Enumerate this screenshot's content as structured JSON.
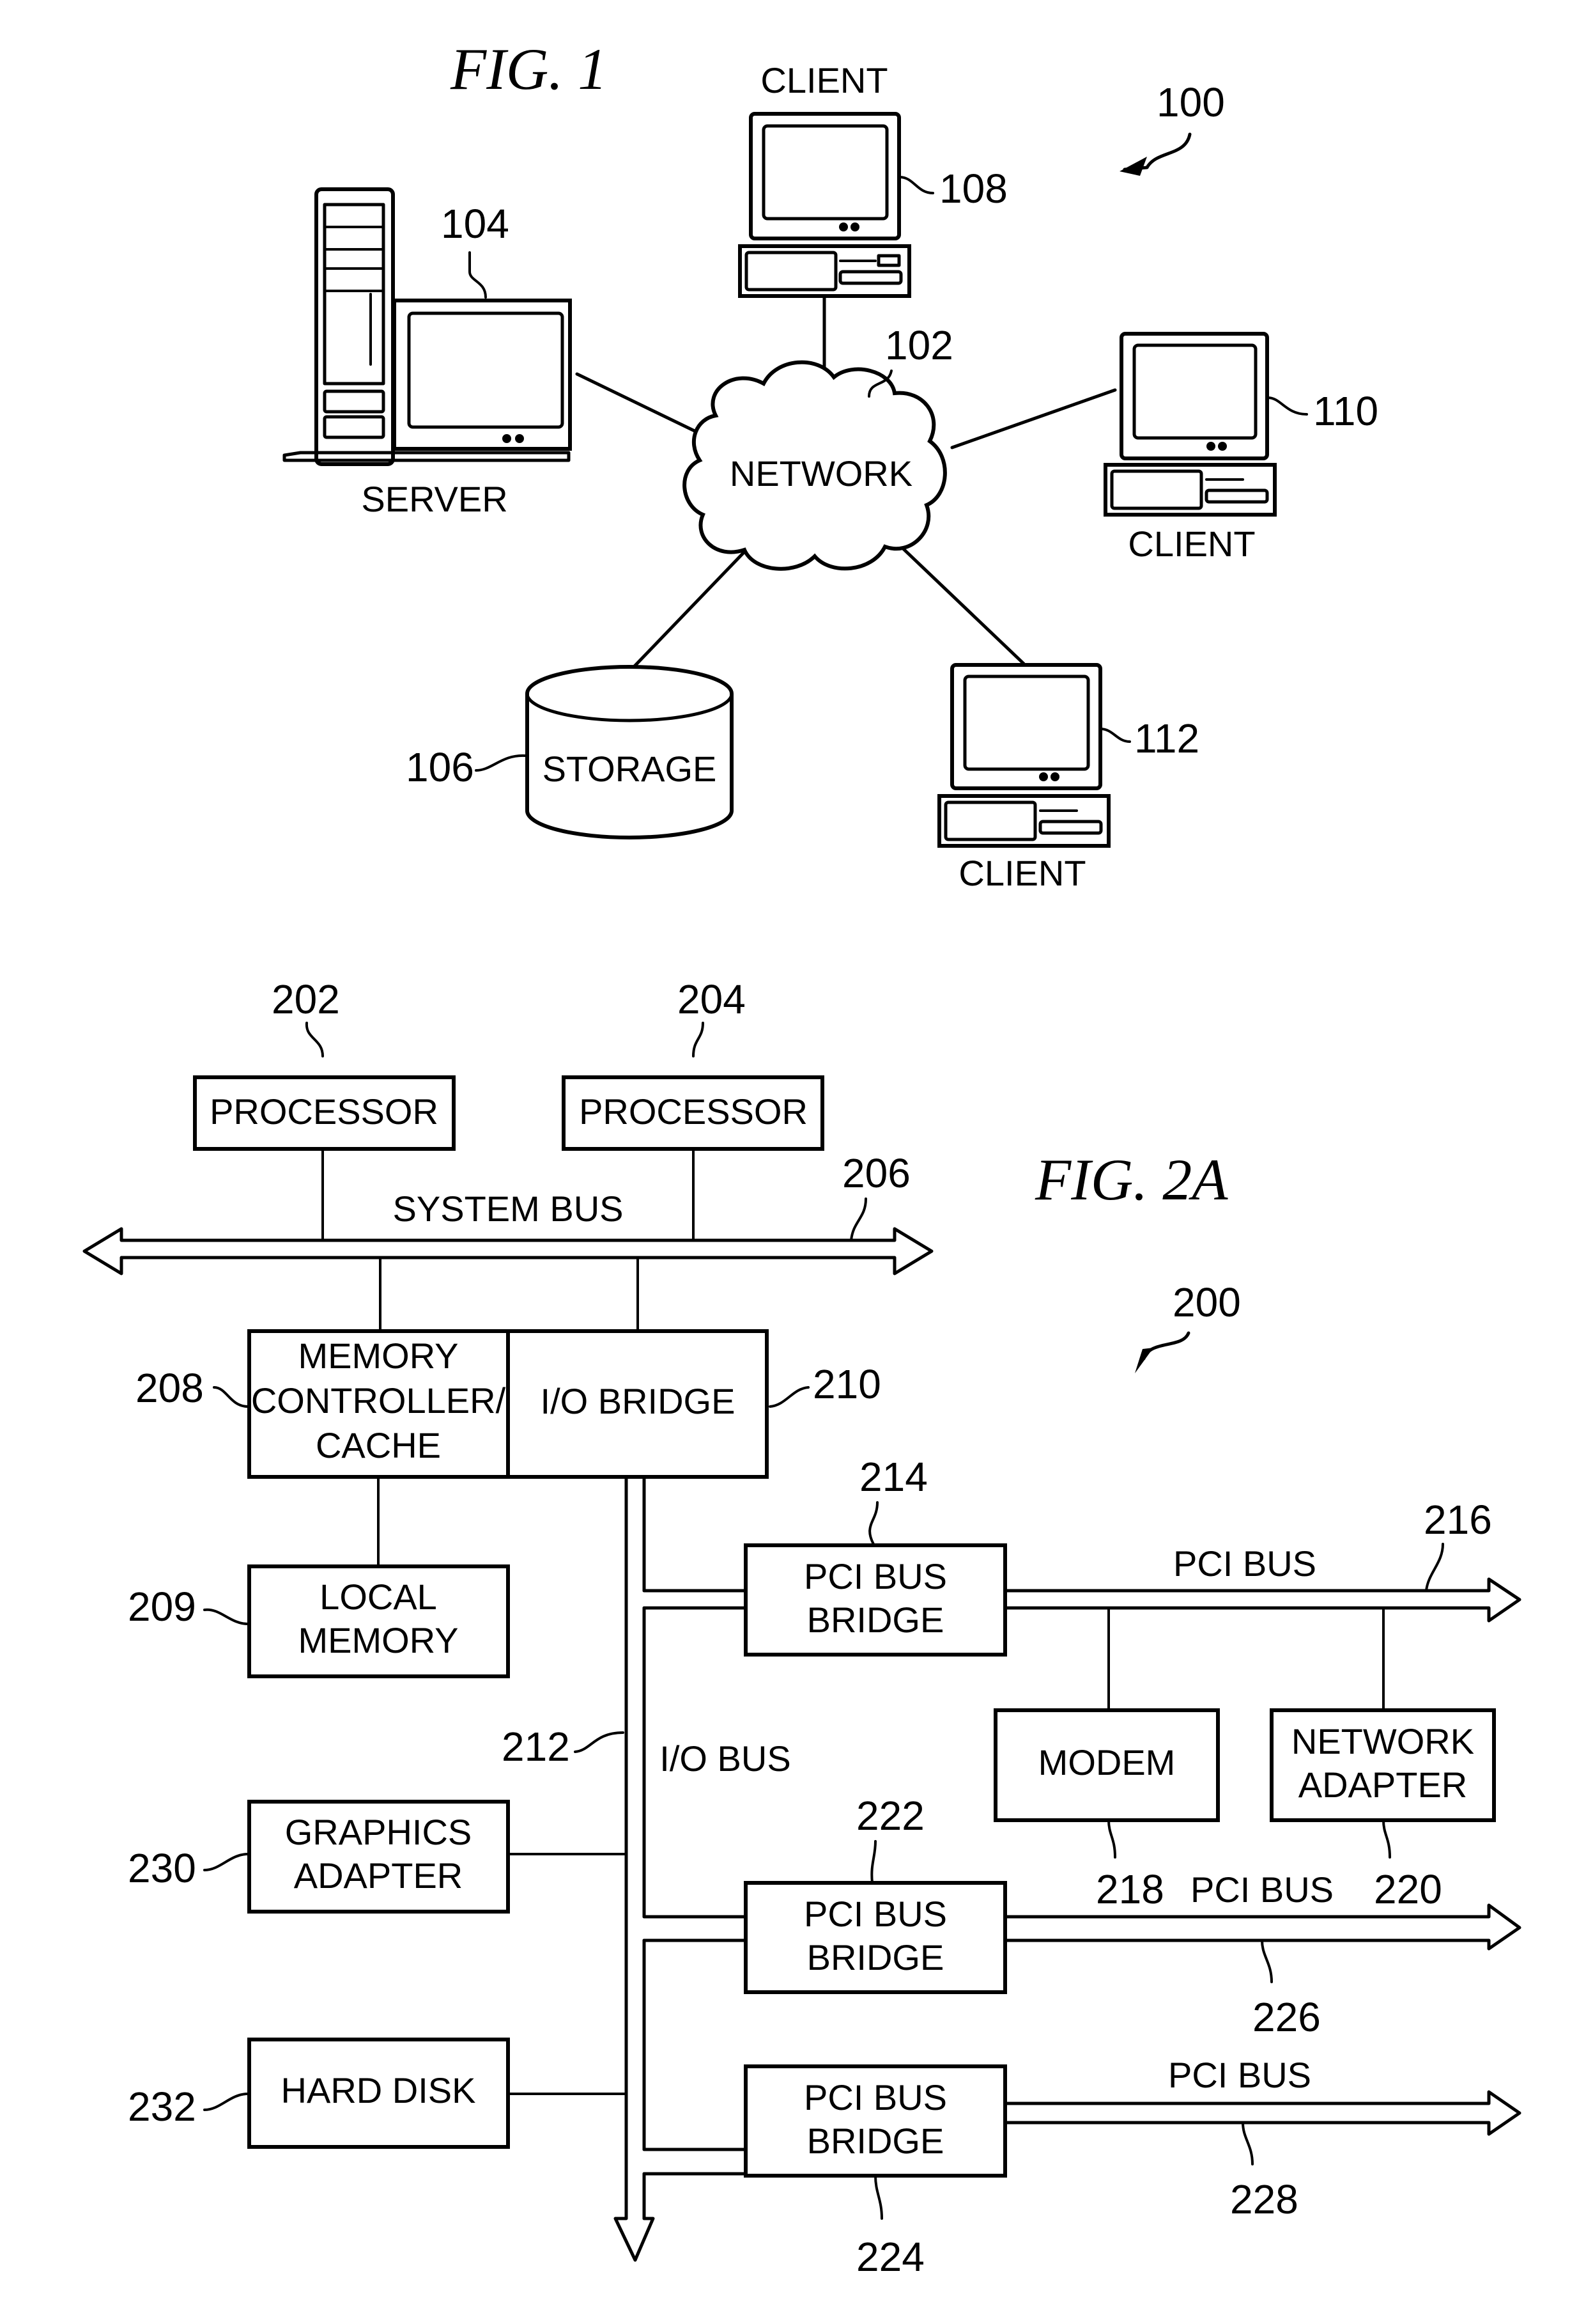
{
  "fig1": {
    "title": "FIG. 1",
    "system_ref": "100",
    "network": {
      "label": "NETWORK",
      "ref": "102"
    },
    "server": {
      "label": "SERVER",
      "ref": "104"
    },
    "storage": {
      "label": "STORAGE",
      "ref": "106"
    },
    "clients": [
      {
        "label": "CLIENT",
        "ref": "108"
      },
      {
        "label": "CLIENT",
        "ref": "110"
      },
      {
        "label": "CLIENT",
        "ref": "112"
      }
    ]
  },
  "fig2a": {
    "title": "FIG. 2A",
    "system_ref": "200",
    "processors": [
      {
        "label": "PROCESSOR",
        "ref": "202"
      },
      {
        "label": "PROCESSOR",
        "ref": "204"
      }
    ],
    "system_bus": {
      "label": "SYSTEM BUS",
      "ref": "206"
    },
    "memory_controller": {
      "lines": [
        "MEMORY",
        "CONTROLLER/",
        "CACHE"
      ],
      "ref": "208"
    },
    "local_memory": {
      "lines": [
        "LOCAL",
        "MEMORY"
      ],
      "ref": "209"
    },
    "io_bridge": {
      "label": "I/O BRIDGE",
      "ref": "210"
    },
    "io_bus": {
      "label": "I/O BUS",
      "ref": "212"
    },
    "pci_bridges": [
      {
        "lines": [
          "PCI BUS",
          "BRIDGE"
        ],
        "ref": "214"
      },
      {
        "lines": [
          "PCI BUS",
          "BRIDGE"
        ],
        "ref": "222"
      },
      {
        "lines": [
          "PCI BUS",
          "BRIDGE"
        ],
        "ref": "224"
      }
    ],
    "pci_buses": [
      {
        "label": "PCI BUS",
        "ref": "216"
      },
      {
        "label": "PCI BUS",
        "ref": "226"
      },
      {
        "label": "PCI BUS",
        "ref": "228"
      }
    ],
    "modem": {
      "label": "MODEM",
      "ref": "218"
    },
    "network_adapter": {
      "lines": [
        "NETWORK",
        "ADAPTER"
      ],
      "ref": "220"
    },
    "graphics_adapter": {
      "lines": [
        "GRAPHICS",
        "ADAPTER"
      ],
      "ref": "230"
    },
    "hard_disk": {
      "label": "HARD DISK",
      "ref": "232"
    }
  }
}
